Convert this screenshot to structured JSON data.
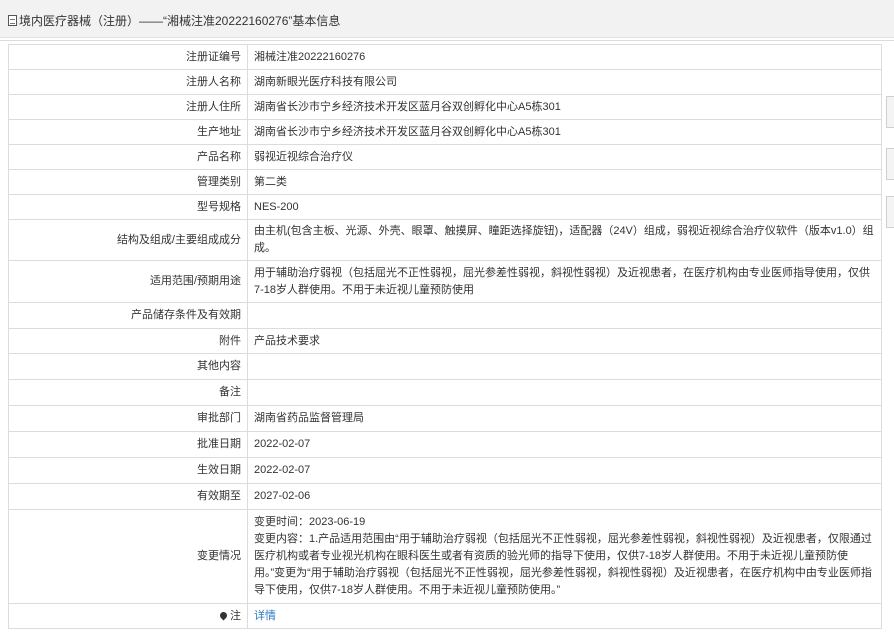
{
  "header": {
    "title": "境内医疗器械（注册）——“湘械注准20222160276”基本信息"
  },
  "rows": [
    {
      "label": "注册证编号",
      "value": "湘械注准20222160276"
    },
    {
      "label": "注册人名称",
      "value": "湖南新眼光医疗科技有限公司"
    },
    {
      "label": "注册人住所",
      "value": "湖南省长沙市宁乡经济技术开发区蓝月谷双创孵化中心A5栋301"
    },
    {
      "label": "生产地址",
      "value": "湖南省长沙市宁乡经济技术开发区蓝月谷双创孵化中心A5栋301"
    },
    {
      "label": "产品名称",
      "value": "弱视近视综合治疗仪"
    },
    {
      "label": "管理类别",
      "value": "第二类"
    },
    {
      "label": "型号规格",
      "value": "NES-200"
    },
    {
      "label": "结构及组成/主要组成成分",
      "value": "由主机(包含主板、光源、外壳、眼罩、触摸屏、瞳距选择旋钮)，适配器（24V）组成，弱视近视综合治疗仪软件（版本v1.0）组成。"
    },
    {
      "label": "适用范围/预期用途",
      "value": "用于辅助治疗弱视（包括屈光不正性弱视，屈光参差性弱视，斜视性弱视）及近视患者，在医疗机构由专业医师指导使用，仅供7-18岁人群使用。不用于未近视儿童预防使用"
    },
    {
      "label": "产品储存条件及有效期",
      "value": ""
    },
    {
      "label": "附件",
      "value": "产品技术要求"
    },
    {
      "label": "其他内容",
      "value": ""
    },
    {
      "label": "备注",
      "value": ""
    },
    {
      "label": "审批部门",
      "value": "湖南省药品监督管理局"
    },
    {
      "label": "批准日期",
      "value": "2022-02-07"
    },
    {
      "label": "生效日期",
      "value": "2022-02-07"
    },
    {
      "label": "有效期至",
      "value": "2027-02-06"
    }
  ],
  "change": {
    "label": "变更情况",
    "time": "变更时间：2023-06-19",
    "content": "变更内容：1.产品适用范围由“用于辅助治疗弱视（包括屈光不正性弱视，屈光参差性弱视，斜视性弱视）及近视患者，仅限通过医疗机构或者专业视光机构在眼科医生或者有资质的验光师的指导下使用，仅供7-18岁人群使用。不用于未近视儿童预防使用。”变更为“用于辅助治疗弱视（包括屈光不正性弱视，屈光参差性弱视，斜视性弱视）及近视患者，在医疗机构中由专业医师指导下使用，仅供7-18岁人群使用。不用于未近视儿童预防使用。”"
  },
  "note": {
    "label": "注",
    "link": "详情"
  }
}
